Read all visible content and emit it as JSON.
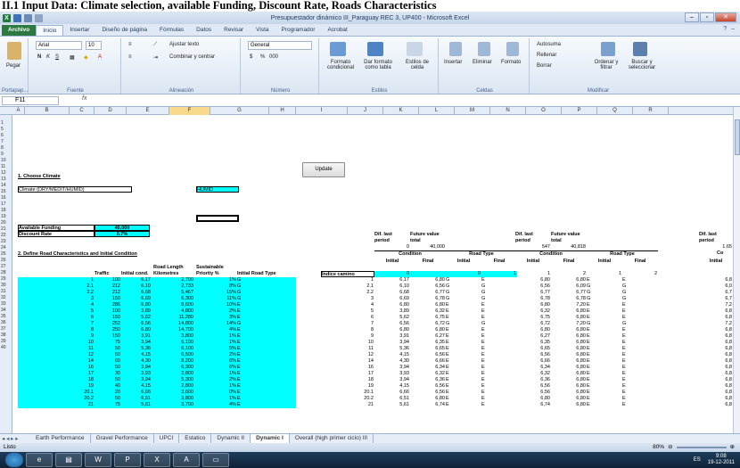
{
  "caption": "II.1 Input Data: Climate selection, available Funding, Discount Rate, Roads Characteristics",
  "window": {
    "title": "Presupuestador dinámico III_Paraguay REC 3, UP400 - Microsoft Excel",
    "minimize": "–",
    "maximize": "▫",
    "close": "✕"
  },
  "tabs": [
    "Archivo",
    "Inicio",
    "Insertar",
    "Diseño de página",
    "Fórmulas",
    "Datos",
    "Revisar",
    "Vista",
    "Programador",
    "Acrobat"
  ],
  "ribbon": {
    "clipboard": {
      "paste": "Pegar",
      "label": "Portapap..."
    },
    "font": {
      "name": "Arial",
      "size": "10",
      "bold": "N",
      "italic": "K",
      "underline": "S",
      "label": "Fuente"
    },
    "alignment": {
      "wrap": "Ajustar texto",
      "merge": "Combinar y centrar",
      "label": "Alineación"
    },
    "number": {
      "format": "General",
      "currency": "$",
      "percent": "%",
      "thousands": "000",
      "label": "Número"
    },
    "styles": {
      "cond": "Formato condicional",
      "table": "Dar formato como tabla",
      "cell": "Estilos de celda",
      "label": "Estilos"
    },
    "cells": {
      "insert": "Insertar",
      "delete": "Eliminar",
      "format": "Formato",
      "label": "Celdas"
    },
    "editing": {
      "autosum": "Autosuma",
      "fill": "Rellenar",
      "clear": "Borrar",
      "sort": "Ordenar y filtrar",
      "find": "Buscar y seleccionar",
      "label": "Modificar"
    }
  },
  "formula_bar": {
    "cell": "F11",
    "fx": "fx"
  },
  "columns": [
    "A",
    "B",
    "C",
    "D",
    "E",
    "F",
    "G",
    "H",
    "I",
    "J",
    "K",
    "L",
    "M",
    "N",
    "O",
    "P",
    "Q",
    "R"
  ],
  "row_numbers": [
    "1",
    "5",
    "6",
    "7",
    "8",
    "9",
    "10",
    "11",
    "12",
    "13",
    "14",
    "15",
    "16",
    "17",
    "18",
    "19",
    "20",
    "21",
    "22",
    "23",
    "24",
    "25",
    "26",
    "27",
    "28",
    "29",
    "30",
    "31",
    "32",
    "33",
    "34",
    "35",
    "36",
    "37",
    "38",
    "39",
    "40"
  ],
  "sheet": {
    "choose_climate": "1. Choose Climate",
    "climate_label": "Climate (DRY/MEDIT/HUMID)",
    "climate_value": "HUMID",
    "update": "Update",
    "funding_label": "Available Funding",
    "funding_value": "40,000",
    "discount_label": "Discount Rate",
    "discount_value": "0.7%",
    "define_roads": "2. Define Road Characteristics and Initial Condition",
    "hdr_road_id": "Road Id",
    "hdr_traffic": "Traffic AADT",
    "hdr_initial_cond": "Initial cond. UPCI",
    "hdr_road_length": "Road Length Kilometres",
    "hdr_sustainable": "Sustainable Priority %",
    "hdr_initial_type": "Initial Road Type E/G/PAV",
    "hdr_dif_last": "Dif. last period",
    "hdr_future": "Future value total",
    "hdr_condition": "Condition",
    "hdr_road_type": "Road Type",
    "hdr_initial": "Initial",
    "hdr_final": "Final",
    "indice": "Indice camino",
    "block1_top": [
      "0",
      "40,000"
    ],
    "block2_top": [
      "547",
      "40,818"
    ],
    "block3_label": "Dif. last period",
    "block3_val": "1,65",
    "block3_cond": "Co",
    "block1_row19": [
      "0",
      "",
      "0",
      "1"
    ],
    "block2_row19": [
      "1",
      "2",
      "1",
      "2"
    ]
  },
  "rows": [
    {
      "id": "1",
      "aadt": "100",
      "upci": "6,17",
      "len": "2,700",
      "pri": "1%",
      "type": "G",
      "idx": "1",
      "i1": "6,17",
      "f1": "6,80",
      "t1": "G",
      "t2": "E",
      "i2": "6,80",
      "f2": "6,80",
      "t3": "E",
      "t4": "E",
      "r": "6,8"
    },
    {
      "id": "2.1",
      "aadt": "212",
      "upci": "6,10",
      "len": "2,733",
      "pri": "8%",
      "type": "G",
      "idx": "2.1",
      "i1": "6,10",
      "f1": "6,56",
      "t1": "G",
      "t2": "G",
      "i2": "6,56",
      "f2": "6,09",
      "t3": "G",
      "t4": "G",
      "r": "6,0"
    },
    {
      "id": "2.2",
      "aadt": "212",
      "upci": "6,68",
      "len": "5,467",
      "pri": "15%",
      "type": "G",
      "idx": "2.2",
      "i1": "6,68",
      "f1": "6,77",
      "t1": "G",
      "t2": "G",
      "i2": "6,77",
      "f2": "6,77",
      "t3": "G",
      "t4": "G",
      "r": "6,7"
    },
    {
      "id": "3",
      "aadt": "150",
      "upci": "6,69",
      "len": "6,300",
      "pri": "11%",
      "type": "G",
      "idx": "3",
      "i1": "6,69",
      "f1": "6,78",
      "t1": "G",
      "t2": "G",
      "i2": "6,78",
      "f2": "6,78",
      "t3": "G",
      "t4": "G",
      "r": "6,7"
    },
    {
      "id": "4",
      "aadt": "286",
      "upci": "6,80",
      "len": "8,600",
      "pri": "10%",
      "type": "E",
      "idx": "4",
      "i1": "6,80",
      "f1": "6,80",
      "t1": "E",
      "t2": "E",
      "i2": "6,80",
      "f2": "7,20",
      "t3": "E",
      "t4": "E",
      "r": "7,2"
    },
    {
      "id": "5",
      "aadt": "100",
      "upci": "3,89",
      "len": "4,800",
      "pri": "2%",
      "type": "E",
      "idx": "5",
      "i1": "3,89",
      "f1": "6,32",
      "t1": "E",
      "t2": "E",
      "i2": "6,32",
      "f2": "6,80",
      "t3": "E",
      "t4": "E",
      "r": "6,8"
    },
    {
      "id": "6",
      "aadt": "150",
      "upci": "5,62",
      "len": "11,280",
      "pri": "3%",
      "type": "E",
      "idx": "6",
      "i1": "5,62",
      "f1": "6,75",
      "t1": "E",
      "t2": "E",
      "i2": "6,75",
      "f2": "6,80",
      "t3": "E",
      "t4": "E",
      "r": "6,8"
    },
    {
      "id": "7",
      "aadt": "252",
      "upci": "6,56",
      "len": "14,800",
      "pri": "14%",
      "type": "G",
      "idx": "7",
      "i1": "6,56",
      "f1": "6,72",
      "t1": "G",
      "t2": "G",
      "i2": "6,72",
      "f2": "7,20",
      "t3": "G",
      "t4": "G",
      "r": "7,2"
    },
    {
      "id": "8",
      "aadt": "250",
      "upci": "6,80",
      "len": "14,700",
      "pri": "4%",
      "type": "E",
      "idx": "8",
      "i1": "6,80",
      "f1": "6,80",
      "t1": "E",
      "t2": "E",
      "i2": "6,80",
      "f2": "6,80",
      "t3": "E",
      "t4": "E",
      "r": "6,8"
    },
    {
      "id": "9",
      "aadt": "150",
      "upci": "3,91",
      "len": "3,800",
      "pri": "1%",
      "type": "E",
      "idx": "9",
      "i1": "3,91",
      "f1": "6,27",
      "t1": "E",
      "t2": "E",
      "i2": "6,27",
      "f2": "6,80",
      "t3": "E",
      "t4": "E",
      "r": "6,8"
    },
    {
      "id": "10",
      "aadt": "75",
      "upci": "3,94",
      "len": "6,100",
      "pri": "1%",
      "type": "E",
      "idx": "10",
      "i1": "3,94",
      "f1": "6,35",
      "t1": "E",
      "t2": "E",
      "i2": "6,35",
      "f2": "6,80",
      "t3": "E",
      "t4": "E",
      "r": "6,8"
    },
    {
      "id": "11",
      "aadt": "50",
      "upci": "5,36",
      "len": "6,100",
      "pri": "5%",
      "type": "E",
      "idx": "11",
      "i1": "5,36",
      "f1": "6,65",
      "t1": "E",
      "t2": "E",
      "i2": "6,65",
      "f2": "6,80",
      "t3": "E",
      "t4": "E",
      "r": "6,8"
    },
    {
      "id": "12",
      "aadt": "50",
      "upci": "4,15",
      "len": "6,500",
      "pri": "2%",
      "type": "E",
      "idx": "12",
      "i1": "4,15",
      "f1": "6,56",
      "t1": "E",
      "t2": "E",
      "i2": "6,56",
      "f2": "6,80",
      "t3": "E",
      "t4": "E",
      "r": "6,8"
    },
    {
      "id": "14",
      "aadt": "60",
      "upci": "4,30",
      "len": "8,200",
      "pri": "6%",
      "type": "E",
      "idx": "14",
      "i1": "4,30",
      "f1": "6,66",
      "t1": "E",
      "t2": "E",
      "i2": "6,66",
      "f2": "6,80",
      "t3": "E",
      "t4": "E",
      "r": "6,8"
    },
    {
      "id": "16",
      "aadt": "50",
      "upci": "3,94",
      "len": "6,300",
      "pri": "6%",
      "type": "E",
      "idx": "16",
      "i1": "3,94",
      "f1": "6,34",
      "t1": "E",
      "t2": "E",
      "i2": "6,34",
      "f2": "6,80",
      "t3": "E",
      "t4": "E",
      "r": "6,8"
    },
    {
      "id": "17",
      "aadt": "30",
      "upci": "3,93",
      "len": "2,800",
      "pri": "1%",
      "type": "E",
      "idx": "17",
      "i1": "3,93",
      "f1": "6,32",
      "t1": "E",
      "t2": "E",
      "i2": "6,32",
      "f2": "6,80",
      "t3": "E",
      "t4": "E",
      "r": "6,8"
    },
    {
      "id": "18",
      "aadt": "50",
      "upci": "3,94",
      "len": "5,300",
      "pri": "2%",
      "type": "E",
      "idx": "18",
      "i1": "3,94",
      "f1": "6,36",
      "t1": "E",
      "t2": "E",
      "i2": "6,36",
      "f2": "6,80",
      "t3": "E",
      "t4": "E",
      "r": "6,8"
    },
    {
      "id": "19",
      "aadt": "40",
      "upci": "4,15",
      "len": "2,800",
      "pri": "1%",
      "type": "E",
      "idx": "19",
      "i1": "4,15",
      "f1": "6,56",
      "t1": "E",
      "t2": "E",
      "i2": "6,56",
      "f2": "6,80",
      "t3": "E",
      "t4": "E",
      "r": "6,8"
    },
    {
      "id": "20.1",
      "aadt": "20",
      "upci": "6,66",
      "len": "3,600",
      "pri": "0%",
      "type": "E",
      "idx": "20.1",
      "i1": "6,66",
      "f1": "6,56",
      "t1": "E",
      "t2": "E",
      "i2": "6,56",
      "f2": "6,80",
      "t3": "E",
      "t4": "E",
      "r": "6,8"
    },
    {
      "id": "20.2",
      "aadt": "50",
      "upci": "6,51",
      "len": "3,800",
      "pri": "1%",
      "type": "E",
      "idx": "20.2",
      "i1": "6,51",
      "f1": "6,80",
      "t1": "E",
      "t2": "E",
      "i2": "6,80",
      "f2": "6,80",
      "t3": "E",
      "t4": "E",
      "r": "6,8"
    },
    {
      "id": "21",
      "aadt": "75",
      "upci": "5,61",
      "len": "3,700",
      "pri": "4%",
      "type": "E",
      "idx": "21",
      "i1": "5,61",
      "f1": "6,74",
      "t1": "E",
      "t2": "E",
      "i2": "6,74",
      "f2": "6,80",
      "t3": "E",
      "t4": "E",
      "r": "6,8"
    }
  ],
  "sheet_tabs": [
    "Earth Performance",
    "Gravel Performance",
    "UPCI",
    "Estatico",
    "Dynamic II",
    "Dynamic I",
    "Overall (high primer ciclo) III"
  ],
  "active_sheet": "Dynamic I",
  "status": {
    "ready": "Listo",
    "zoom": "80%"
  },
  "tray": {
    "lang": "ES",
    "time": "9:08",
    "date": "19-12-2011"
  }
}
